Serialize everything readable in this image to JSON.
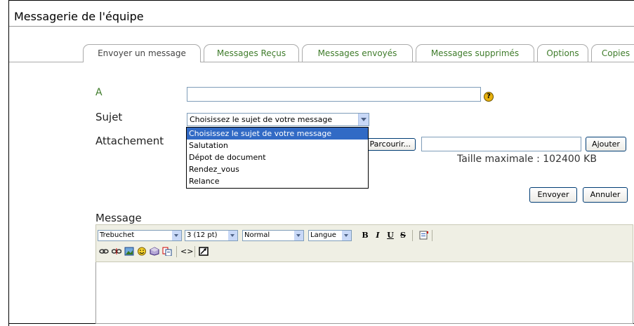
{
  "window": {
    "title": "Messagerie de l'équipe"
  },
  "tabs": [
    {
      "label": "Envoyer un message",
      "active": true
    },
    {
      "label": "Messages Reçus"
    },
    {
      "label": "Messages envoyés"
    },
    {
      "label": "Messages supprimés"
    },
    {
      "label": "Options"
    },
    {
      "label": "Copies"
    }
  ],
  "form": {
    "to_label": "A",
    "to_value": "",
    "help_symbol": "?",
    "subject_label": "Sujet",
    "subject_selected": "Choisissez le sujet de votre message",
    "subject_options": [
      "Choisissez le sujet de votre message",
      "Salutation",
      "Dépot de document",
      "Rendez_vous",
      "Relance"
    ],
    "attachment_label": "Attachement",
    "browse_label": "Parcourir...",
    "add_label": "Ajouter",
    "max_size_text": "Taille maximale : 102400 KB",
    "send_label": "Envoyer",
    "cancel_label": "Annuler",
    "message_label": "Message"
  },
  "editor": {
    "font": "Trebuchet",
    "size": "3 (12 pt)",
    "format": "Normal",
    "language": "Langue",
    "bold": "B",
    "italic": "I",
    "underline": "U",
    "strike": "S",
    "source_symbol": "<>"
  },
  "colors": {
    "tab_text": "#3f7c2b",
    "selection": "#316ac5",
    "toolbar_bg": "#efefe4"
  }
}
